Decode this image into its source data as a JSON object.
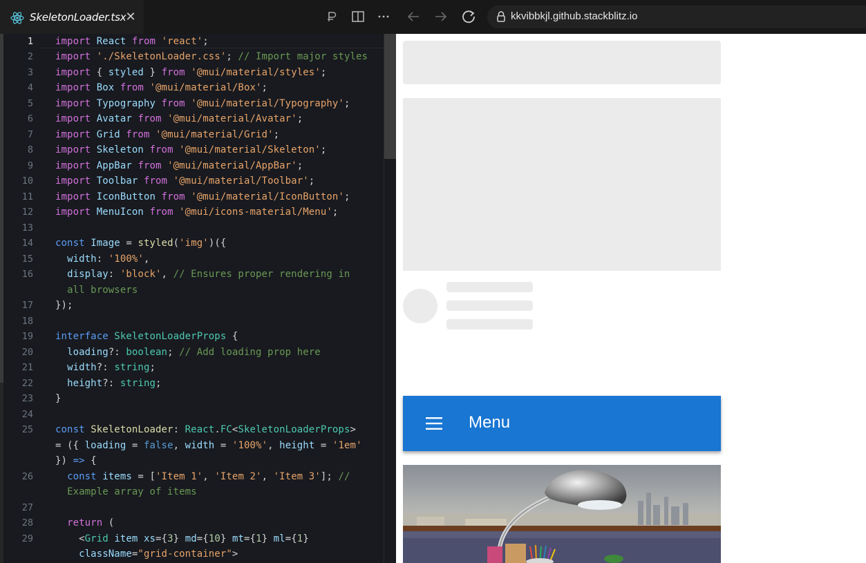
{
  "tab": {
    "label": "SkeletonLoader.tsx",
    "close": "✕"
  },
  "browser": {
    "url": "kkvibbkjl.github.stackblitz.io"
  },
  "editor": {
    "line_numbers": [
      "1",
      "2",
      "3",
      "4",
      "5",
      "6",
      "7",
      "8",
      "9",
      "10",
      "11",
      "12",
      "13",
      "14",
      "15",
      "16",
      "17",
      "18",
      "19",
      "20",
      "21",
      "22",
      "23",
      "24",
      "25",
      "26",
      "27",
      "28",
      "29"
    ],
    "active_line": "1"
  },
  "preview": {
    "appbar_title": "Menu"
  },
  "colors": {
    "accent": "#1976d2",
    "skeleton": "#ebebeb"
  },
  "icons": [
    "react-icon",
    "close-icon",
    "split-editor-icon",
    "more-icon",
    "back-icon",
    "forward-icon",
    "reload-icon",
    "lock-icon",
    "hamburger-menu-icon"
  ]
}
